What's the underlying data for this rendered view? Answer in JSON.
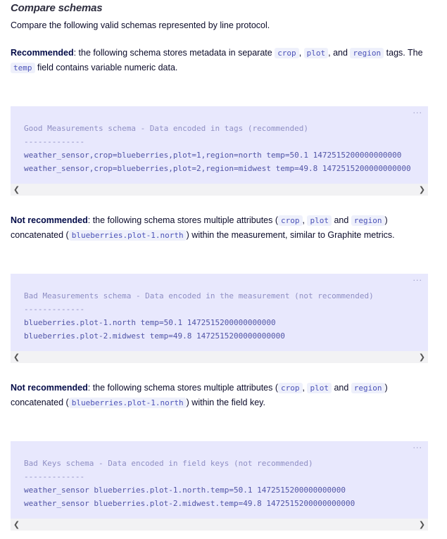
{
  "heading": "Compare schemas",
  "intro": "Compare the following valid schemas represented by line protocol.",
  "recommended": {
    "label": "Recommended",
    "t1": ": the following schema stores metadata in separate ",
    "code1": "crop",
    "t2": ", ",
    "code2": "plot",
    "t3": ", and ",
    "code3": "region",
    "t4": " tags. The",
    "code4": "temp",
    "t5": " field contains variable numeric data."
  },
  "block1": {
    "more": "···",
    "comment": "Good Measurements schema - Data encoded in tags (recommended)",
    "separator": "-------------",
    "line1": "weather_sensor,crop=blueberries,plot=1,region=north temp=50.1 1472515200000000000",
    "line2": "weather_sensor,crop=blueberries,plot=2,region=midwest temp=49.8 1472515200000000000"
  },
  "not_rec_1": {
    "label": "Not recommended",
    "t1": ": the following schema stores multiple attributes (",
    "code1": "crop",
    "t2": ", ",
    "code2": "plot",
    "t3": " and ",
    "code3": "region",
    "t4": ")",
    "t5": "concatenated (",
    "code4": "blueberries.plot-1.north",
    "t6": ") within the measurement, similar to Graphite metrics."
  },
  "block2": {
    "more": "···",
    "comment": "Bad Measurements schema - Data encoded in the measurement (not recommended)",
    "separator": "-------------",
    "line1": "blueberries.plot-1.north temp=50.1 1472515200000000000",
    "line2": "blueberries.plot-2.midwest temp=49.8 1472515200000000000"
  },
  "not_rec_2": {
    "label": "Not recommended",
    "t1": ": the following schema stores multiple attributes (",
    "code1": "crop",
    "t2": ", ",
    "code2": "plot",
    "t3": " and ",
    "code3": "region",
    "t4": ")",
    "t5": "concatenated (",
    "code4": "blueberries.plot-1.north",
    "t6": ") within the field key."
  },
  "block3": {
    "more": "···",
    "comment": "Bad Keys schema - Data encoded in field keys (not recommended)",
    "separator": "-------------",
    "line1": "weather_sensor blueberries.plot-1.north.temp=50.1 1472515200000000000",
    "line2": "weather_sensor blueberries.plot-2.midwest.temp=49.8 1472515200000000000"
  },
  "scroll_left": "❮",
  "scroll_right": "❯"
}
